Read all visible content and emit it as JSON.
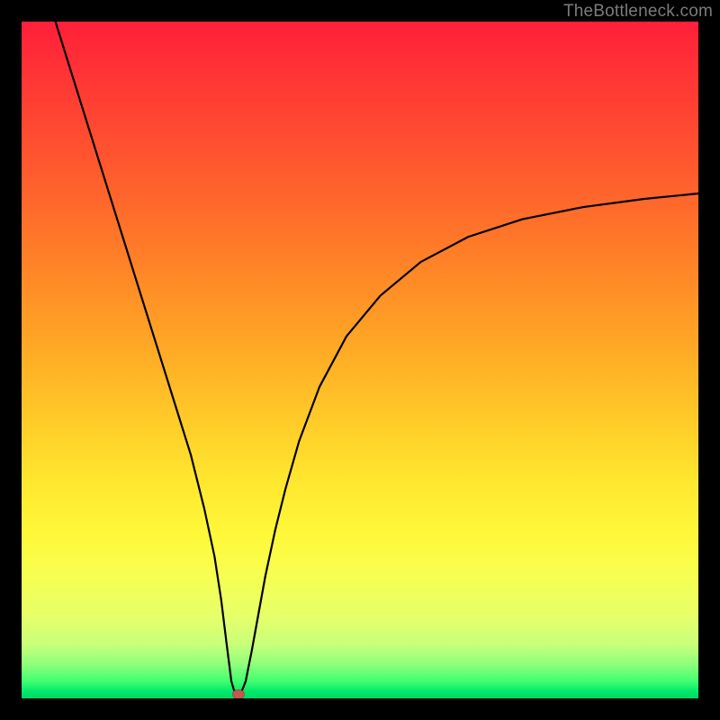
{
  "watermark": "TheBottleneck.com",
  "chart_data": {
    "type": "line",
    "title": "",
    "xlabel": "",
    "ylabel": "",
    "xlim": [
      0,
      100
    ],
    "ylim": [
      0,
      100
    ],
    "grid": false,
    "series": [
      {
        "name": "bottleneck-curve",
        "x": [
          5,
          10,
          15,
          20,
          22.5,
          25,
          27,
          28.5,
          29.5,
          30.3,
          31,
          31.6,
          32.3,
          33.1,
          34,
          35,
          36,
          37.5,
          39,
          41,
          44,
          48,
          53,
          59,
          66,
          74,
          83,
          92,
          100
        ],
        "y": [
          100,
          84,
          68,
          52,
          44,
          36,
          28,
          21,
          14.5,
          8,
          2.5,
          0.5,
          0.5,
          2.5,
          7,
          12.5,
          18,
          25,
          31,
          38,
          46,
          53.5,
          59.5,
          64.5,
          68.2,
          70.8,
          72.6,
          73.8,
          74.6
        ]
      }
    ],
    "marker": {
      "x": 32,
      "y": 0.5,
      "color": "#c05a50"
    },
    "background_gradient": {
      "top": "#ff1f3a",
      "bottom": "#00d766",
      "stops": [
        "red",
        "orange",
        "yellow",
        "green"
      ]
    }
  }
}
